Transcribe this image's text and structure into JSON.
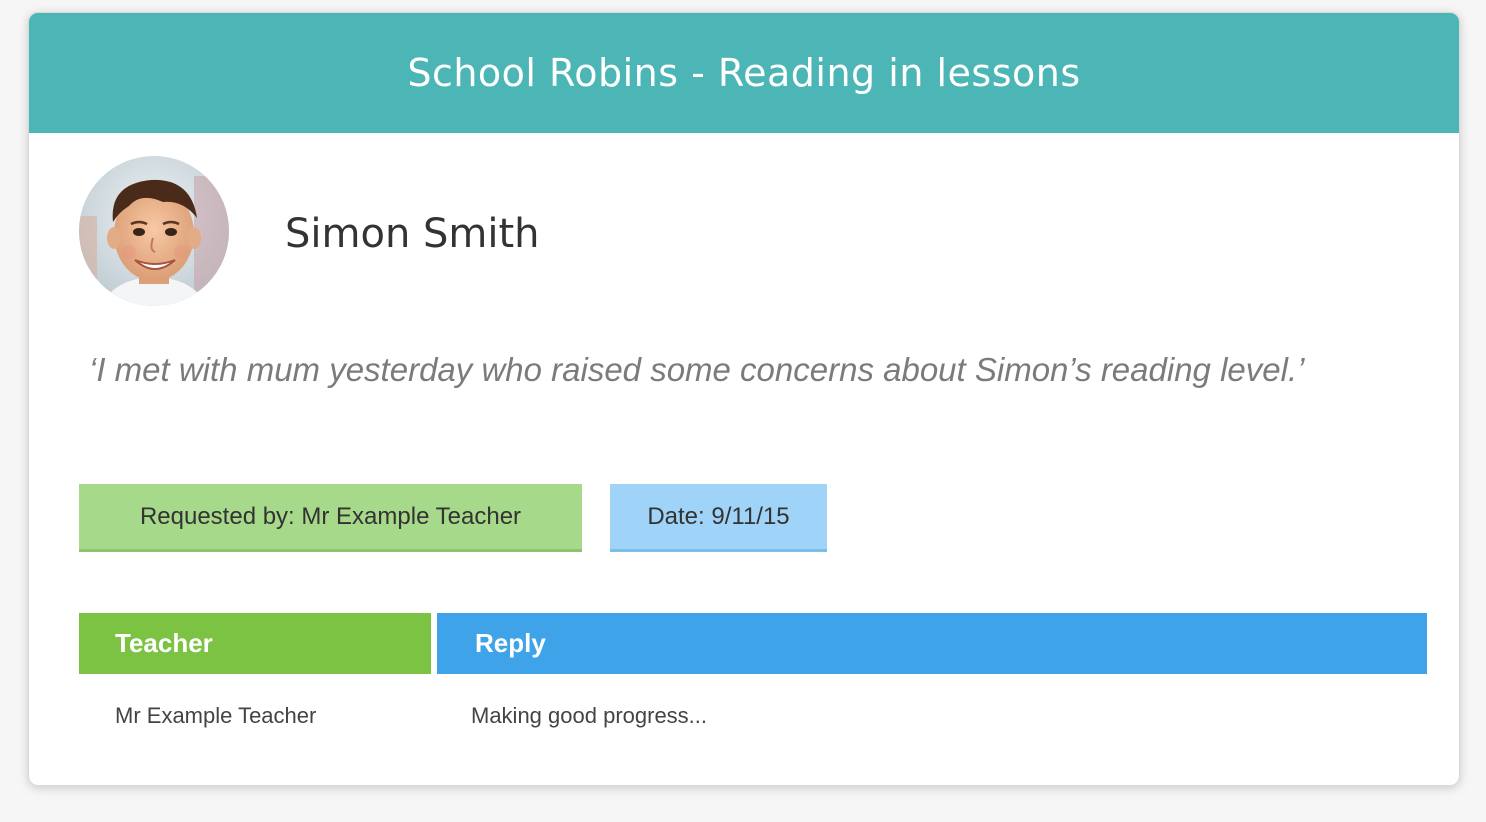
{
  "header": {
    "title": "School Robins - Reading in lessons"
  },
  "student": {
    "name": "Simon Smith",
    "avatar_icon": "child-photo-avatar"
  },
  "note": {
    "quote": "‘I met with mum yesterday who raised some concerns about Simon’s reading level.’"
  },
  "badges": {
    "requested_by": "Requested by: Mr Example Teacher",
    "date": "Date: 9/11/15"
  },
  "table": {
    "columns": [
      "Teacher",
      "Reply"
    ],
    "rows": [
      [
        "Mr Example Teacher",
        "Making good progress..."
      ]
    ]
  },
  "colors": {
    "header_teal": "#4bb6b5",
    "requested_green": "#a7d98a",
    "date_blue": "#9fd3f7",
    "teacher_header_green": "#7cc243",
    "reply_header_blue": "#3fa3ea"
  }
}
